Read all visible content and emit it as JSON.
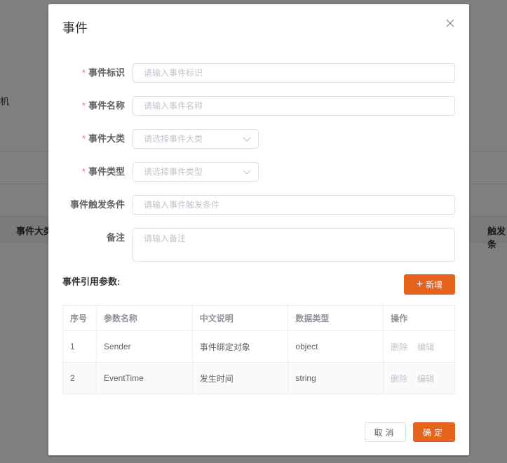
{
  "background": {
    "left_text": "机",
    "col_left": "事件大类",
    "col_right": "触发条"
  },
  "dialog": {
    "title": "事件",
    "fields": {
      "event_id": {
        "label": "事件标识",
        "placeholder": "请输入事件标识",
        "required": true
      },
      "event_name": {
        "label": "事件名称",
        "placeholder": "请输入事件名称",
        "required": true
      },
      "event_category": {
        "label": "事件大类",
        "placeholder": "请选择事件大类",
        "required": true
      },
      "event_type": {
        "label": "事件类型",
        "placeholder": "请选择事件类型",
        "required": true
      },
      "trigger": {
        "label": "事件触发条件",
        "placeholder": "请输入事件触发条件",
        "required": false
      },
      "remark": {
        "label": "备注",
        "placeholder": "请输入备注",
        "required": false
      }
    },
    "required_mark": "*",
    "params_title": "事件引用参数:",
    "add_button": "新增",
    "table": {
      "headers": [
        "序号",
        "参数名称",
        "中文说明",
        "数据类型",
        "操作"
      ],
      "rows": [
        {
          "no": "1",
          "name": "Sender",
          "desc": "事件绑定对象",
          "type": "object"
        },
        {
          "no": "2",
          "name": "EventTime",
          "desc": "发生时间",
          "type": "string"
        }
      ],
      "delete_label": "删除",
      "edit_label": "编辑"
    },
    "cancel_button": "取消",
    "confirm_button": "确定"
  },
  "colors": {
    "accent": "#e6631e",
    "required": "#f56c6c"
  }
}
